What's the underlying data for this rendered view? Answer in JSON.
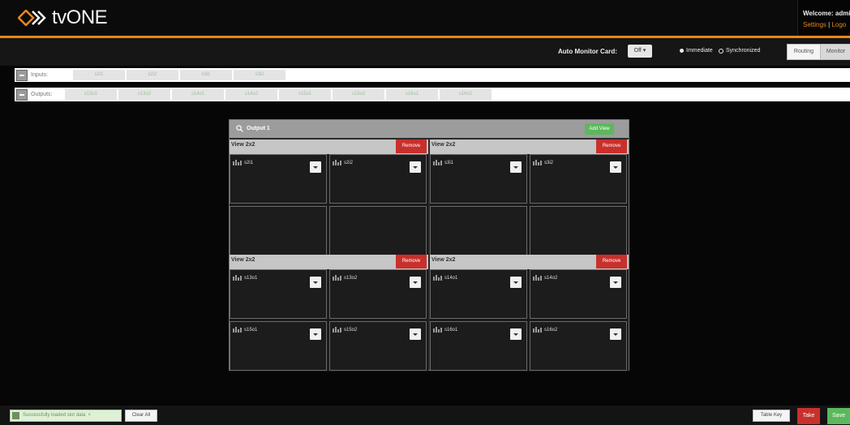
{
  "header": {
    "logo_text": "tvONE",
    "welcome_text": "Welcome: admin",
    "settings_link": "Settings",
    "separator": "|",
    "logout_link": "Logo"
  },
  "toolbar": {
    "auto_monitor_label": "Auto Monitor Card:",
    "auto_monitor_value": "Off ▾",
    "radio_immediate": "Immediate",
    "radio_synchronized": "Synchronized",
    "radio_selected": "Immediate",
    "tab_routing": "Routing",
    "tab_monitor": "Monitor"
  },
  "inputs": {
    "label": "Inputs:",
    "items": [
      "s2i1",
      "s2i2",
      "s3i1",
      "s3i2"
    ]
  },
  "outputs": {
    "label": "Outputs:",
    "items": [
      "s13o1",
      "s13o2",
      "s14o1",
      "s14o2",
      "s15o1",
      "s15o2",
      "s16o1",
      "s16o2"
    ]
  },
  "panel": {
    "title": "Output 1",
    "add_view_label": "Add View",
    "views": [
      {
        "title": "View 2x2",
        "remove_label": "Remove",
        "cells": [
          "s2i1",
          "s2i2",
          "",
          ""
        ]
      },
      {
        "title": "View 2x2",
        "remove_label": "Remove",
        "cells": [
          "s3i1",
          "s3i2",
          "",
          ""
        ]
      },
      {
        "title": "View 2x2",
        "remove_label": "Remove",
        "cells": [
          "s13o1",
          "s13o2",
          "s15o1",
          "s15o2"
        ]
      },
      {
        "title": "View 2x2",
        "remove_label": "Remove",
        "cells": [
          "s14o1",
          "s14o2",
          "s16o1",
          "s16o2"
        ]
      }
    ]
  },
  "footer": {
    "status_message": "Successfully loaded slot data",
    "status_close": "×",
    "clear_all_label": "Clear All",
    "table_key_label": "Table Key",
    "take_label": "Take",
    "save_label": "Save"
  },
  "colors": {
    "brand_accent": "#e8871e",
    "success": "#5cb85c",
    "danger": "#c9302c"
  }
}
